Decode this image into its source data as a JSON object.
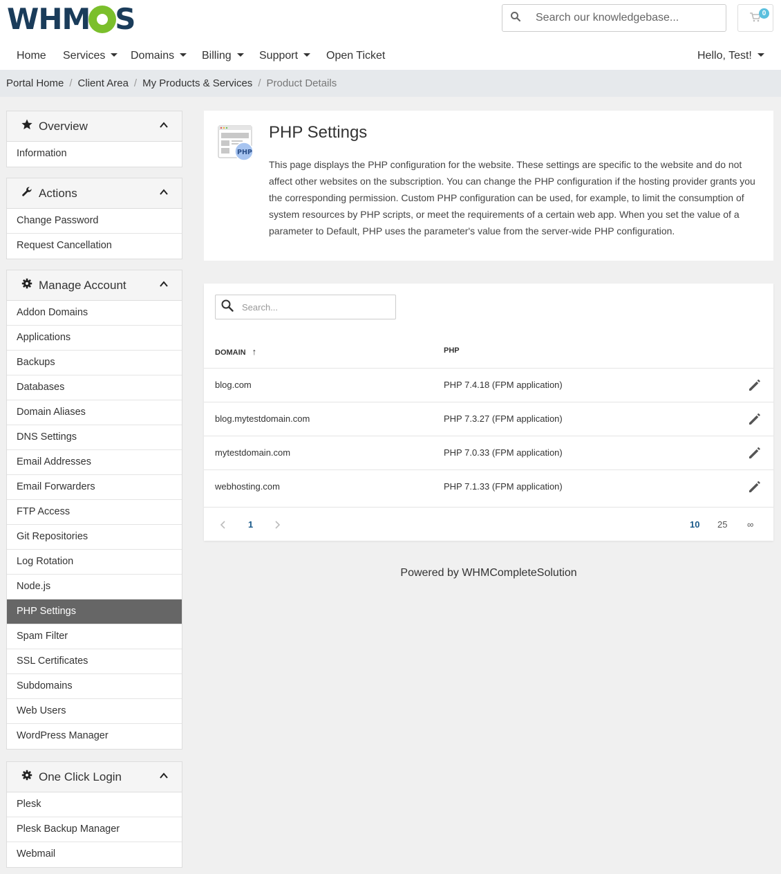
{
  "brand": {
    "logo_left": "WHM",
    "logo_right": "S"
  },
  "header": {
    "search_placeholder": "Search our knowledgebase...",
    "cart_count": "0"
  },
  "nav": {
    "home": "Home",
    "services": "Services",
    "domains": "Domains",
    "billing": "Billing",
    "support": "Support",
    "open_ticket": "Open Ticket",
    "user": "Hello, Test!"
  },
  "breadcrumb": [
    "Portal Home",
    "Client Area",
    "My Products & Services",
    "Product Details"
  ],
  "sidebar": {
    "overview": {
      "title": "Overview",
      "items": [
        "Information"
      ]
    },
    "actions": {
      "title": "Actions",
      "items": [
        "Change Password",
        "Request Cancellation"
      ]
    },
    "manage": {
      "title": "Manage Account",
      "items": [
        "Addon Domains",
        "Applications",
        "Backups",
        "Databases",
        "Domain Aliases",
        "DNS Settings",
        "Email Addresses",
        "Email Forwarders",
        "FTP Access",
        "Git Repositories",
        "Log Rotation",
        "Node.js",
        "PHP Settings",
        "Spam Filter",
        "SSL Certificates",
        "Subdomains",
        "Web Users",
        "WordPress Manager"
      ],
      "active": "PHP Settings"
    },
    "oneclick": {
      "title": "One Click Login",
      "items": [
        "Plesk",
        "Plesk Backup Manager",
        "Webmail"
      ]
    }
  },
  "page": {
    "title": "PHP Settings",
    "icon_label": "PHP",
    "description": "This page displays the PHP configuration for the website. These settings are specific to the website and do not affect other websites on the subscription. You can change the PHP configuration if the hosting provider grants you the corresponding permission. Custom PHP configuration can be used, for example, to limit the consumption of system resources by PHP scripts, or meet the requirements of a certain web app. When you set the value of a parameter to Default, PHP uses the parameter's value from the server-wide PHP configuration."
  },
  "table": {
    "search_placeholder": "Search...",
    "col_domain": "DOMAIN",
    "sort_indicator": "↑",
    "col_php": "PHP",
    "rows": [
      {
        "domain": "blog.com",
        "php": "PHP 7.4.18 (FPM application)"
      },
      {
        "domain": "blog.mytestdomain.com",
        "php": "PHP 7.3.27 (FPM application)"
      },
      {
        "domain": "mytestdomain.com",
        "php": "PHP 7.0.33 (FPM application)"
      },
      {
        "domain": "webhosting.com",
        "php": "PHP 7.1.33 (FPM application)"
      }
    ],
    "pagination": {
      "current_page": "1",
      "sizes": [
        "10",
        "25",
        "∞"
      ],
      "active_size": "10"
    }
  },
  "footer": {
    "text": "Powered by WHMCompleteSolution"
  },
  "colors": {
    "accent": "#1a5a8a",
    "active_item": "#666666",
    "badge": "#5bc0de",
    "logo_dark": "#1a3c5a",
    "logo_gear": "#7bbf2c"
  }
}
